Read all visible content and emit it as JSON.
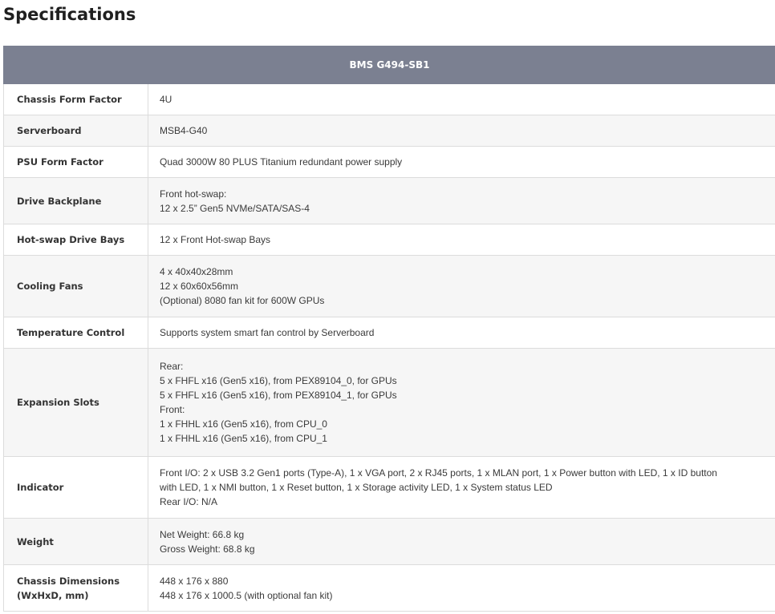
{
  "page": {
    "title": "Specifications"
  },
  "table": {
    "model": "BMS G494-SB1",
    "rows": [
      {
        "label": [
          "Chassis Form Factor"
        ],
        "values": [
          "4U"
        ]
      },
      {
        "label": [
          "Serverboard"
        ],
        "values": [
          "MSB4-G40"
        ]
      },
      {
        "label": [
          "PSU Form Factor"
        ],
        "values": [
          "Quad 3000W 80 PLUS Titanium redundant power supply"
        ]
      },
      {
        "label": [
          "Drive Backplane"
        ],
        "values": [
          "Front hot-swap:",
          "12 x 2.5” Gen5 NVMe/SATA/SAS-4"
        ]
      },
      {
        "label": [
          "Hot-swap Drive Bays"
        ],
        "values": [
          "12 x Front Hot-swap Bays"
        ]
      },
      {
        "label": [
          "Cooling Fans"
        ],
        "values": [
          "4 x 40x40x28mm",
          "12 x 60x60x56mm",
          "(Optional) 8080 fan kit for 600W GPUs"
        ]
      },
      {
        "label": [
          "Temperature Control"
        ],
        "values": [
          "Supports system smart fan control by Serverboard"
        ]
      },
      {
        "label": [
          "Expansion Slots"
        ],
        "values": [
          "Rear:",
          "5 x FHFL x16 (Gen5 x16), from PEX89104_0, for GPUs",
          "5 x FHFL x16 (Gen5 x16), from PEX89104_1, for GPUs",
          "Front:",
          "1 x FHHL x16 (Gen5 x16), from CPU_0",
          "1 x FHHL x16 (Gen5 x16), from CPU_1"
        ]
      },
      {
        "label": [
          "Indicator"
        ],
        "values": [
          "Front I/O: 2 x USB 3.2 Gen1 ports (Type-A), 1 x VGA port, 2 x RJ45 ports, 1 x MLAN port, 1 x Power button with LED, 1 x ID button",
          "with LED, 1 x NMI button, 1 x Reset button, 1 x Storage activity LED, 1 x System status LED",
          "Rear I/O: N/A"
        ]
      },
      {
        "label": [
          "Weight"
        ],
        "values": [
          "Net Weight: 66.8 kg",
          "Gross Weight: 68.8 kg"
        ]
      },
      {
        "label": [
          "Chassis Dimensions",
          "(WxHxD, mm)"
        ],
        "values": [
          "448 x 176 x 880",
          "448 x 176 x 1000.5 (with optional fan kit)"
        ]
      }
    ]
  }
}
